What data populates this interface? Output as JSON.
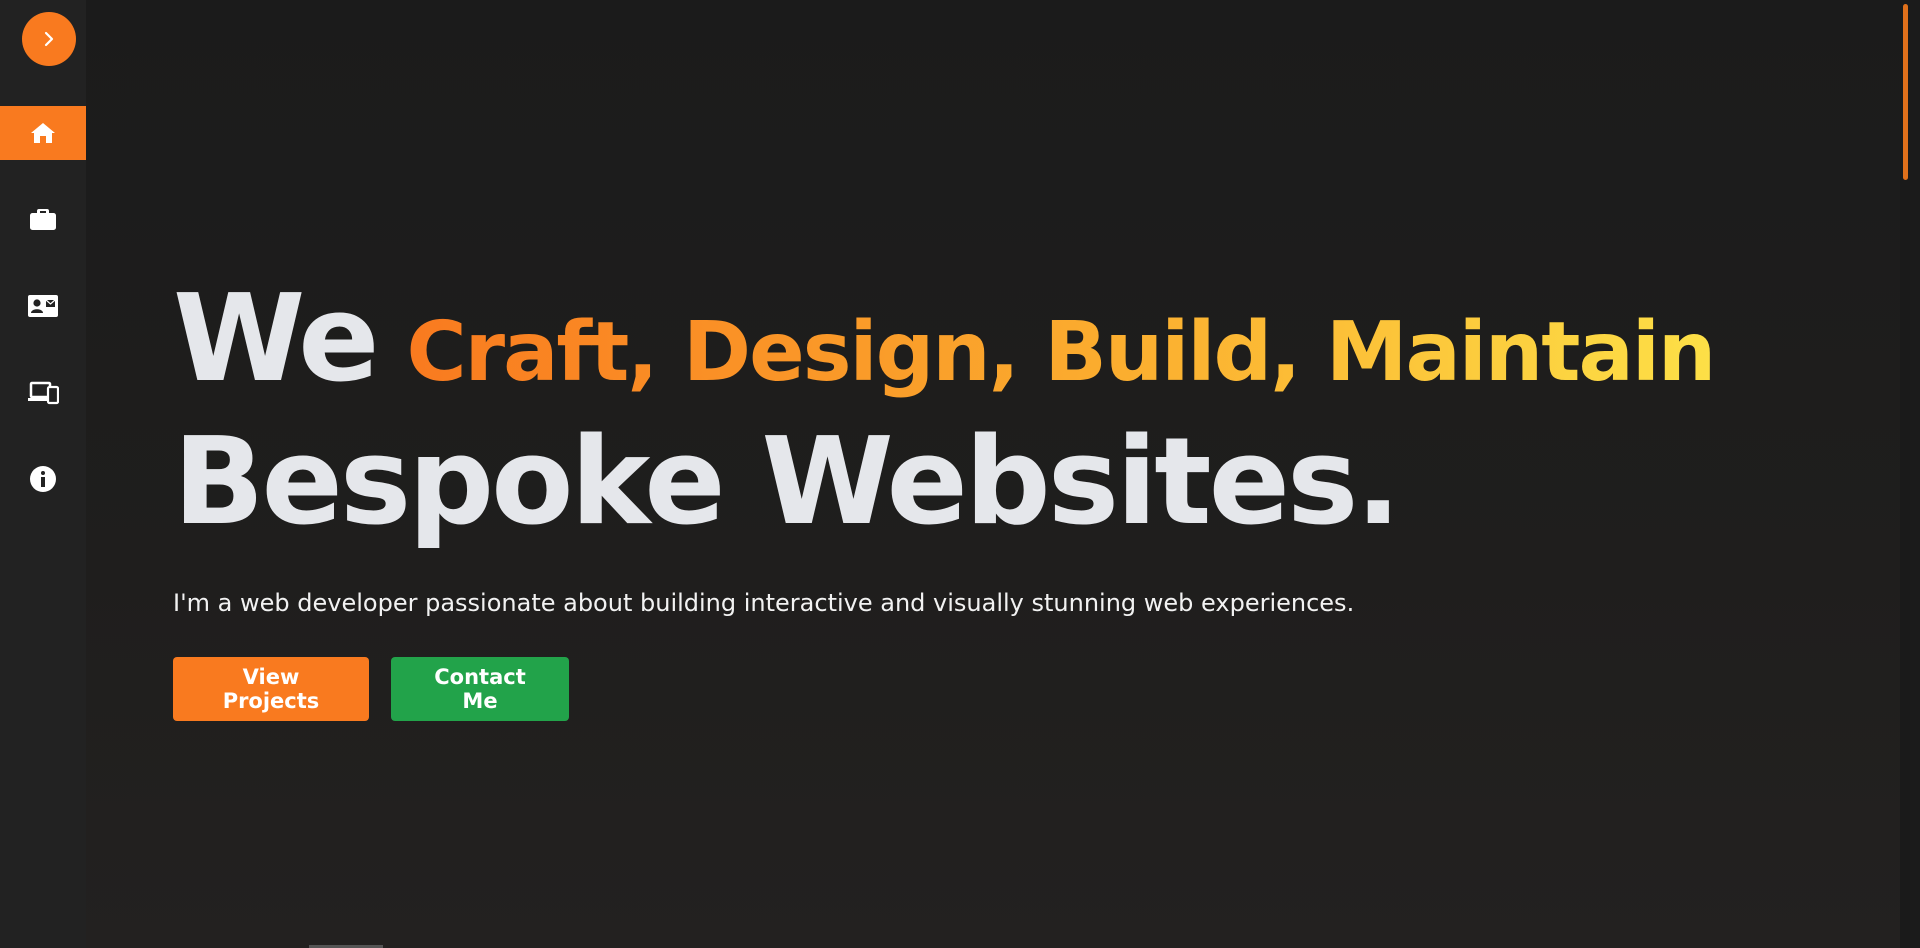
{
  "sidebar": {
    "toggle": {
      "icon": "chevron-right-icon"
    },
    "items": [
      {
        "icon": "home-icon",
        "active": true
      },
      {
        "icon": "briefcase-icon",
        "active": false
      },
      {
        "icon": "contact-card-icon",
        "active": false
      },
      {
        "icon": "devices-icon",
        "active": false
      },
      {
        "icon": "info-icon",
        "active": false
      }
    ]
  },
  "hero": {
    "headline_we": "We",
    "headline_highlight": "Craft, Design, Build, Maintain",
    "headline_line2": "Bespoke Websites.",
    "subtitle": "I'm a web developer passionate about building interactive and visually stunning web experiences.",
    "primary_button": "View Projects",
    "secondary_button": "Contact Me"
  },
  "colors": {
    "accent": "#f97a1f",
    "gradient_end": "#fde047",
    "success": "#22a34a",
    "background": "#1b1b1b",
    "sidebar": "#222222",
    "text": "#e5e7eb"
  }
}
